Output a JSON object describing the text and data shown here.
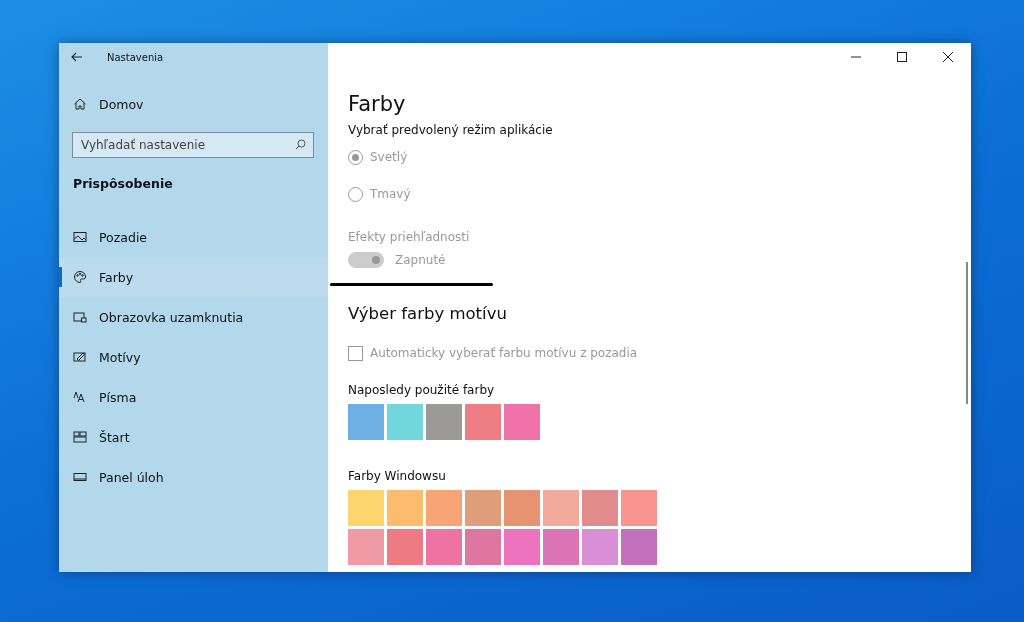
{
  "window": {
    "title": "Nastavenia"
  },
  "sidebar": {
    "home": "Domov",
    "search": {
      "placeholder": "Vyhľadať nastavenie"
    },
    "section": "Prispôsobenie",
    "items": [
      {
        "label": "Pozadie",
        "selected": false
      },
      {
        "label": "Farby",
        "selected": true
      },
      {
        "label": "Obrazovka uzamknutia",
        "selected": false
      },
      {
        "label": "Motívy",
        "selected": false
      },
      {
        "label": "Písma",
        "selected": false
      },
      {
        "label": "Štart",
        "selected": false
      },
      {
        "label": "Panel úloh",
        "selected": false
      }
    ]
  },
  "page": {
    "title": "Farby",
    "app_mode": {
      "label": "Vybrať predvolený režim aplikácie",
      "disabled": true,
      "options": [
        {
          "label": "Svetlý",
          "selected": true
        },
        {
          "label": "Tmavý",
          "selected": false
        }
      ]
    },
    "transparency": {
      "label": "Efekty priehľadnosti",
      "on": true,
      "disabled": true,
      "state_text": "Zapnuté"
    },
    "accent": {
      "title": "Výber farby motívu",
      "auto": {
        "label": "Automaticky vyberať farbu motívu z pozadia",
        "checked": false,
        "disabled": true
      },
      "recent": {
        "label": "Naposledy použité farby",
        "swatches": [
          {
            "color": "#6fb0e4"
          },
          {
            "color": "#72d7dc"
          },
          {
            "color": "#9c9a99"
          },
          {
            "color": "#ef7d84"
          },
          {
            "color": "#ef72a8"
          }
        ]
      },
      "windows": {
        "label": "Farby Windowsu",
        "swatches": [
          {
            "color": "#fdd56e"
          },
          {
            "color": "#fdbb6e"
          },
          {
            "color": "#f7a574"
          },
          {
            "color": "#e09d7a"
          },
          {
            "color": "#e59370"
          },
          {
            "color": "#f3aa9c"
          },
          {
            "color": "#e28b8c"
          },
          {
            "color": "#fa948e"
          },
          {
            "color": "#ef9aa4"
          },
          {
            "color": "#ee7a83"
          },
          {
            "color": "#ef73a2"
          },
          {
            "color": "#dd77a0"
          },
          {
            "color": "#ee73bf"
          },
          {
            "color": "#db73b4"
          },
          {
            "color": "#d98fd5"
          },
          {
            "color": "#c370bd"
          }
        ]
      }
    }
  }
}
